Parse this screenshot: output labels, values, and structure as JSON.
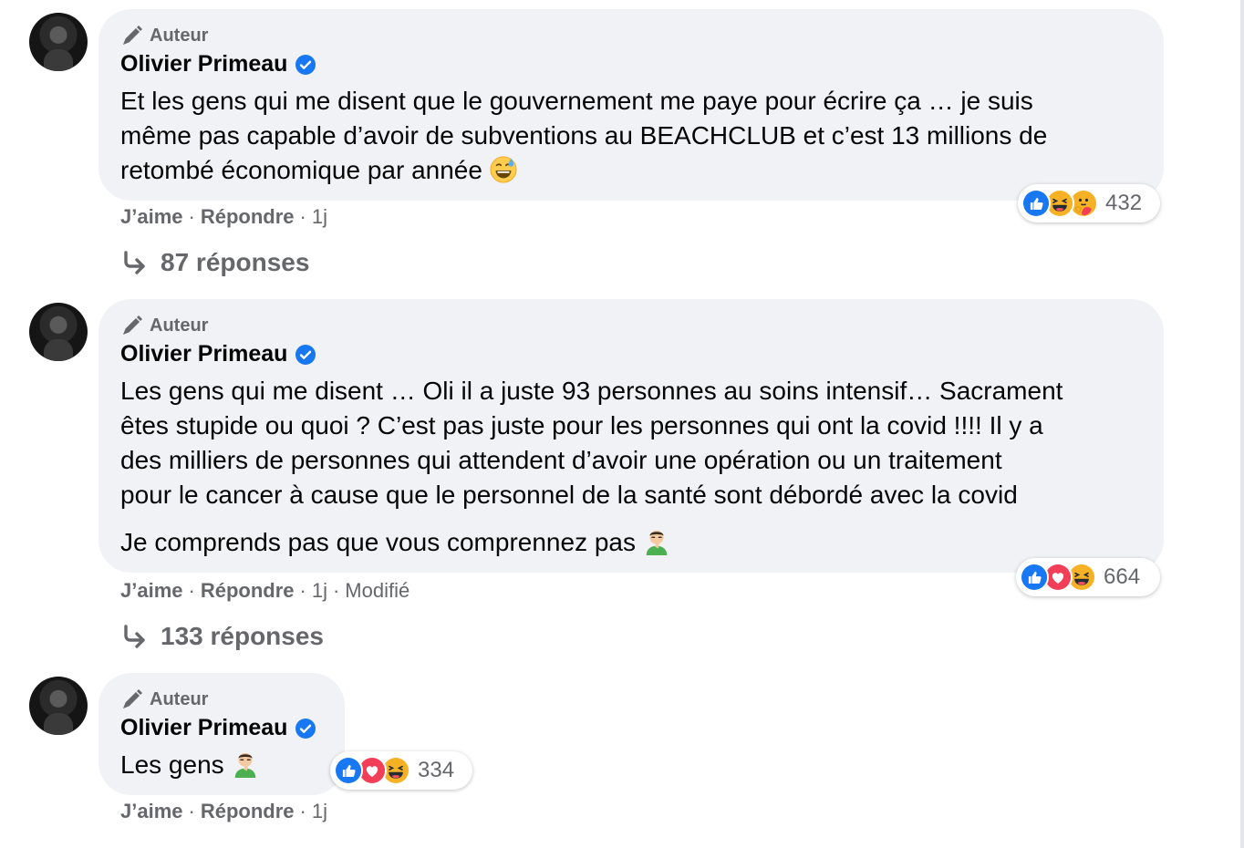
{
  "comments": [
    {
      "badge": "Auteur",
      "author": "Olivier Primeau",
      "text": "Et les gens qui me disent que le gouvernement me paye pour écrire ça … je suis\nmême pas capable d’avoir de subventions au BEACHCLUB et c’est 13 millions de\nretombé économique par année",
      "emoji": "sweat-smile-emoji",
      "reactions": [
        "like",
        "haha",
        "care"
      ],
      "reaction_count": "432",
      "actions": {
        "like": "J’aime",
        "reply": "Répondre",
        "time": "1j"
      },
      "replies": "87 réponses"
    },
    {
      "badge": "Auteur",
      "author": "Olivier Primeau",
      "text": "Les gens qui me disent … Oli il a juste 93 personnes au soins intensif… Sacrament\nêtes stupide ou quoi ? C’est pas juste pour les personnes qui ont la covid !!!! Il y a\ndes milliers de personnes qui attendent d’avoir une opération ou un traitement\npour le cancer à cause que le personnel de la santé sont débordé avec la covid",
      "text2": "Je comprends pas que vous comprennez pas",
      "emoji": "facepalm-emoji",
      "reactions": [
        "like",
        "love",
        "haha"
      ],
      "reaction_count": "664",
      "actions": {
        "like": "J’aime",
        "reply": "Répondre",
        "time": "1j",
        "edited": "Modifié"
      },
      "replies": "133 réponses"
    },
    {
      "badge": "Auteur",
      "author": "Olivier Primeau",
      "text": "Les gens",
      "emoji": "facepalm-emoji",
      "reactions": [
        "like",
        "love",
        "haha"
      ],
      "reaction_count": "334",
      "actions": {
        "like": "J’aime",
        "reply": "Répondre",
        "time": "1j"
      }
    }
  ],
  "colors": {
    "bubble": "#f0f2f5",
    "secondary_text": "#65676b",
    "like_blue": "#1877f2",
    "love_red": "#f33e58",
    "haha_yellow": "#f7b125"
  }
}
